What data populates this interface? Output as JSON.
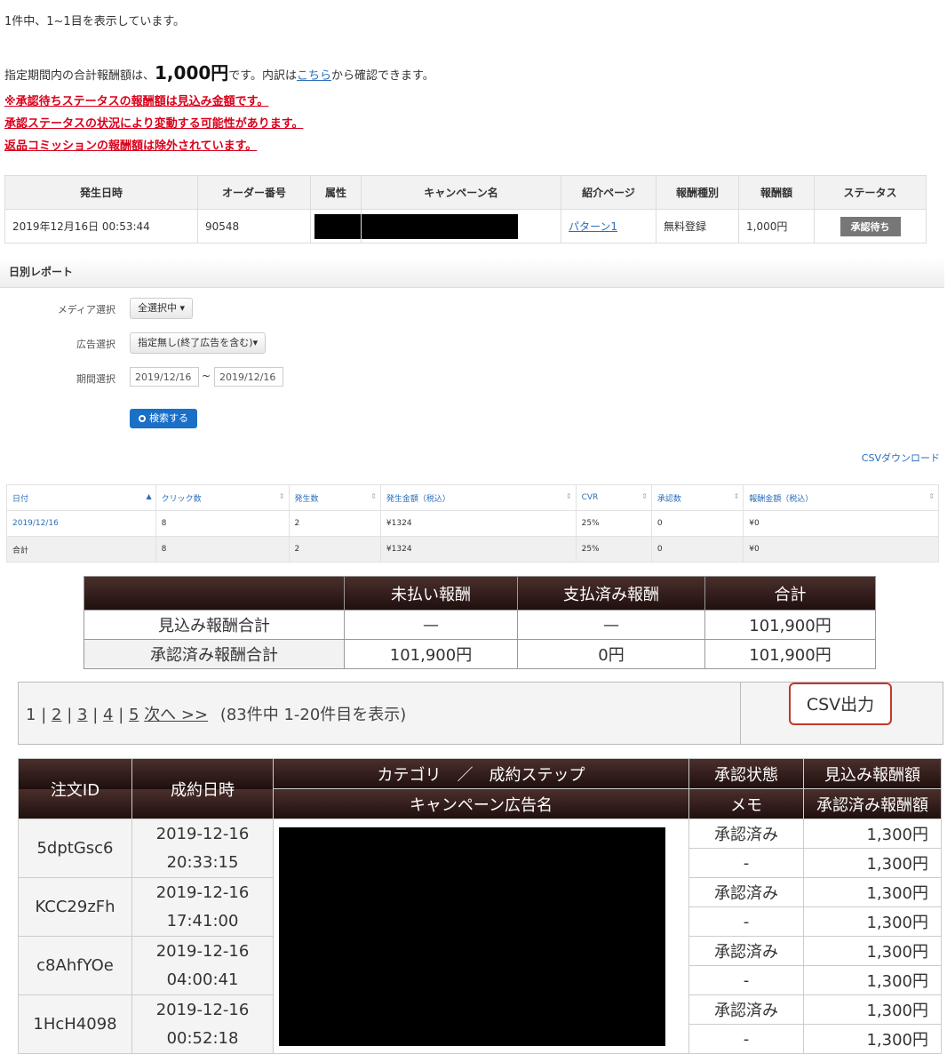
{
  "summary": {
    "count_text": "1件中、1~1目を表示しています。",
    "total_prefix": "指定期間内の合計報酬額は、",
    "total_amount": "1,000円",
    "total_mid": "です。内訳は",
    "total_link": "こちら",
    "total_suffix": "から確認できます。",
    "notes": [
      "※承認待ちステータスの報酬額は見込み金額です。",
      "承認ステータスの状況により変動する可能性があります。",
      "返品コミッションの報酬額は除外されています。"
    ]
  },
  "result_table": {
    "headers": [
      "発生日時",
      "オーダー番号",
      "属性",
      "キャンペーン名",
      "紹介ページ",
      "報酬種別",
      "報酬額",
      "ステータス"
    ],
    "row": {
      "datetime": "2019年12月16日 00:53:44",
      "order_no": "90548",
      "page": "パターン1",
      "type": "無料登録",
      "amount": "1,000円",
      "status": "承認待ち"
    }
  },
  "daily": {
    "title": "日別レポート",
    "media_label": "メディア選択",
    "media_value": "全選択中 ▾",
    "ad_label": "広告選択",
    "ad_value": "指定無し(終了広告を含む)▾",
    "period_label": "期間選択",
    "date_from": "2019/12/16",
    "tilde": "~",
    "date_to": "2019/12/16",
    "search_button": "検索する",
    "csv_link": "CSVダウンロード",
    "headers": [
      "日付",
      "クリック数",
      "発生数",
      "発生金額（税込）",
      "CVR",
      "承認数",
      "報酬金額（税込）"
    ],
    "rows": [
      [
        "2019/12/16",
        "8",
        "2",
        "¥1324",
        "25%",
        "0",
        "¥0"
      ],
      [
        "合計",
        "8",
        "2",
        "¥1324",
        "25%",
        "0",
        "¥0"
      ]
    ]
  },
  "reward_summary": {
    "headers": [
      "",
      "未払い報酬",
      "支払済み報酬",
      "合計"
    ],
    "rows": [
      [
        "見込み報酬合計",
        "—",
        "—",
        "101,900円"
      ],
      [
        "承認済み報酬合計",
        "101,900円",
        "0円",
        "101,900円"
      ]
    ]
  },
  "pager": {
    "p1": "1",
    "p2": "2",
    "p3": "3",
    "p4": "4",
    "p5": "5",
    "next": "次へ >>",
    "sep": "|",
    "info": "(83件中 1-20件目を表示)",
    "csv_button": "CSV出力"
  },
  "orders": {
    "h_id": "注文ID",
    "h_date": "成約日時",
    "h_category": "カテゴリ　／　成約ステップ",
    "h_campaign": "キャンペーン広告名",
    "h_status": "承認状態",
    "h_memo": "メモ",
    "h_expected": "見込み報酬額",
    "h_approved": "承認済み報酬額",
    "rows": [
      {
        "id": "5dptGsc6",
        "date": "2019-12-16",
        "time": "20:33:15",
        "status": "承認済み",
        "memo": "-",
        "expected": "1,300円",
        "approved": "1,300円"
      },
      {
        "id": "KCC29zFh",
        "date": "2019-12-16",
        "time": "17:41:00",
        "status": "承認済み",
        "memo": "-",
        "expected": "1,300円",
        "approved": "1,300円"
      },
      {
        "id": "c8AhfYOe",
        "date": "2019-12-16",
        "time": "04:00:41",
        "status": "承認済み",
        "memo": "-",
        "expected": "1,300円",
        "approved": "1,300円"
      },
      {
        "id": "1HcH4098",
        "date": "2019-12-16",
        "time": "00:52:18",
        "status": "承認済み",
        "memo": "-",
        "expected": "1,300円",
        "approved": "1,300円"
      }
    ]
  }
}
